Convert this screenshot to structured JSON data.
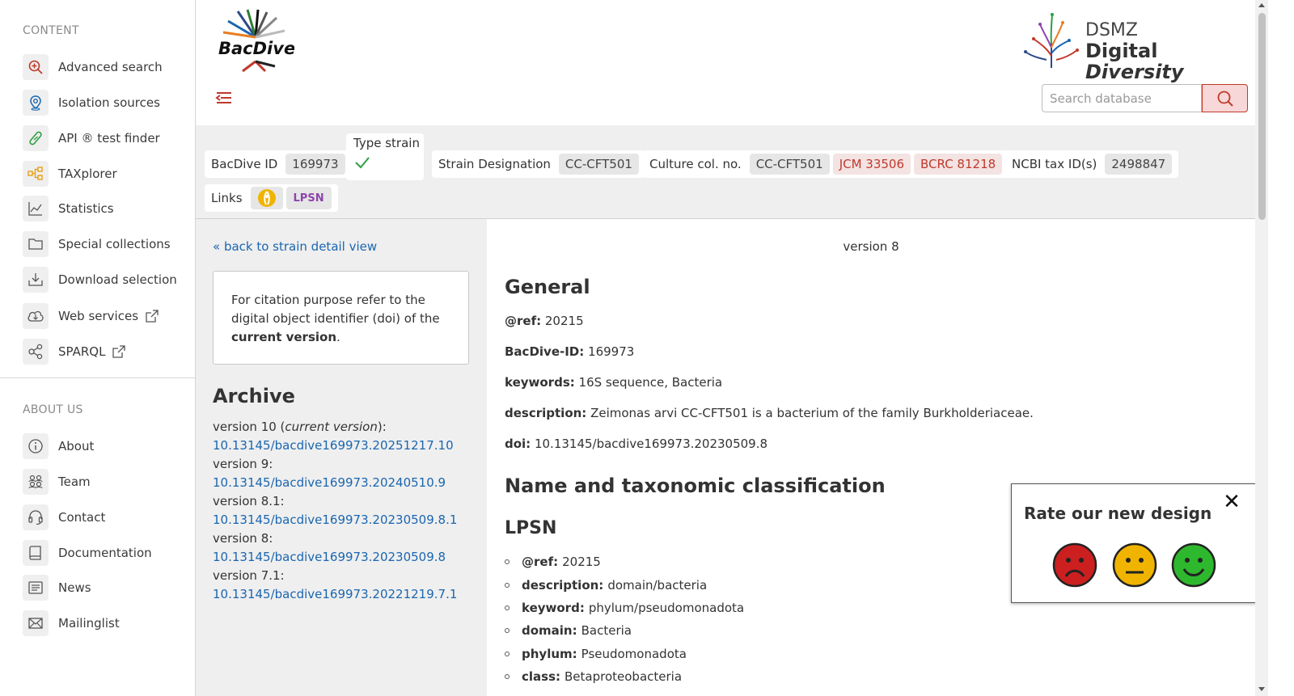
{
  "sidebar": {
    "content_title": "CONTENT",
    "content_items": [
      {
        "label": "Advanced search",
        "icon": "search-plus-icon",
        "color": "#c0392b"
      },
      {
        "label": "Isolation sources",
        "icon": "location-pin-icon",
        "color": "#1a66b0"
      },
      {
        "label": "API ® test finder",
        "icon": "test-tube-icon",
        "color": "#2e9e44"
      },
      {
        "label": "TAXplorer",
        "icon": "hierarchy-icon",
        "color": "#e6a01c"
      },
      {
        "label": "Statistics",
        "icon": "line-chart-icon",
        "color": "#555555"
      },
      {
        "label": "Special collections",
        "icon": "folder-icon",
        "color": "#555555"
      },
      {
        "label": "Download selection",
        "icon": "download-icon",
        "color": "#555555"
      },
      {
        "label": "Web services",
        "icon": "cloud-icon",
        "color": "#555555"
      },
      {
        "label": "SPARQL",
        "icon": "share-nodes-icon",
        "color": "#555555"
      }
    ],
    "about_title": "ABOUT US",
    "about_items": [
      {
        "label": "About",
        "icon": "info-icon"
      },
      {
        "label": "Team",
        "icon": "team-icon"
      },
      {
        "label": "Contact",
        "icon": "headset-icon"
      },
      {
        "label": "Documentation",
        "icon": "book-icon"
      },
      {
        "label": "News",
        "icon": "newspaper-icon"
      },
      {
        "label": "Mailinglist",
        "icon": "envelope-icon"
      }
    ]
  },
  "header": {
    "logo_text": "BacDive",
    "dsmz_line1": "DSMZ",
    "dsmz_line2a": "Digital ",
    "dsmz_line2b": "Diversity",
    "search_placeholder": "Search database"
  },
  "infobar": {
    "bacdive_id_label": "BacDive ID",
    "bacdive_id": "169973",
    "type_strain_label": "Type strain",
    "strain_designation_label": "Strain Designation",
    "strain_designation": "CC-CFT501",
    "culture_label": "Culture col. no.",
    "culture_numbers": [
      "CC-CFT501",
      "JCM 33506",
      "BCRC 81218"
    ],
    "ncbi_label": "NCBI tax ID(s)",
    "ncbi_id": "2498847",
    "links_label": "Links",
    "lpsn_badge": "LPSN"
  },
  "leftcol": {
    "back_link": "« back to strain detail view",
    "cite_text_1": "For citation purpose refer to the digital object identifier (doi) of the ",
    "cite_bold": "current version",
    "cite_text_2": ".",
    "archive_title": "Archive",
    "archive": [
      {
        "version": "version 10 (",
        "current": "current version",
        "suffix": "):",
        "doi": "10.13145/bacdive169973.20251217.10"
      },
      {
        "version": "version 9:",
        "current": "",
        "suffix": "",
        "doi": "10.13145/bacdive169973.20240510.9"
      },
      {
        "version": "version 8.1:",
        "current": "",
        "suffix": "",
        "doi": "10.13145/bacdive169973.20230509.8.1"
      },
      {
        "version": "version 8:",
        "current": "",
        "suffix": "",
        "doi": "10.13145/bacdive169973.20230509.8"
      },
      {
        "version": "version 7.1:",
        "current": "",
        "suffix": "",
        "doi": "10.13145/bacdive169973.20221219.7.1"
      }
    ]
  },
  "main": {
    "version_label": "version 8",
    "general_title": "General",
    "general": [
      {
        "key": "@ref:",
        "value": "20215"
      },
      {
        "key": "BacDive-ID:",
        "value": "169973"
      },
      {
        "key": "keywords:",
        "value": "16S sequence, Bacteria"
      },
      {
        "key": "description:",
        "value": "Zeimonas arvi CC-CFT501 is a bacterium of the family Burkholderiaceae."
      },
      {
        "key": "doi:",
        "value": "10.13145/bacdive169973.20230509.8"
      }
    ],
    "taxonomy_title": "Name and taxonomic classification",
    "lpsn_title": "LPSN",
    "lpsn": [
      {
        "key": "@ref:",
        "value": "20215"
      },
      {
        "key": "description:",
        "value": "domain/bacteria"
      },
      {
        "key": "keyword:",
        "value": "phylum/pseudomonadota"
      },
      {
        "key": "domain:",
        "value": "Bacteria"
      },
      {
        "key": "phylum:",
        "value": "Pseudomonadota"
      },
      {
        "key": "class:",
        "value": "Betaproteobacteria"
      }
    ]
  },
  "rating": {
    "title": "Rate our new design",
    "close": "✕",
    "faces": [
      {
        "name": "sad-face-icon",
        "color": "#cc1f1f"
      },
      {
        "name": "neutral-face-icon",
        "color": "#f0b400"
      },
      {
        "name": "happy-face-icon",
        "color": "#2eb82e"
      }
    ]
  }
}
